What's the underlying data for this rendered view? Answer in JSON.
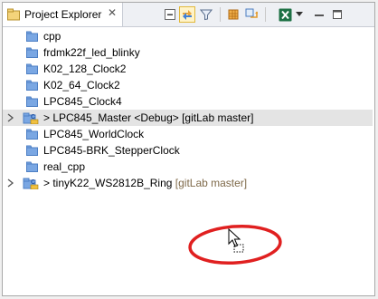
{
  "view": {
    "tab_title": "Project Explorer",
    "close_symbol": "✕",
    "icons": [
      "collapse-all-icon",
      "link-with-editor-icon",
      "filter-icon",
      "new-module-icon",
      "sync-icon",
      "excel-icon",
      "view-menu-icon"
    ]
  },
  "tree": [
    {
      "label": "cpp",
      "type": "folder"
    },
    {
      "label": "frdmk22f_led_blinky",
      "type": "folder"
    },
    {
      "label": "K02_128_Clock2",
      "type": "folder"
    },
    {
      "label": "K02_64_Clock2",
      "type": "folder"
    },
    {
      "label": "LPC845_Clock4",
      "type": "folder"
    },
    {
      "label": "> LPC845_Master <Debug> [gitLab master]",
      "type": "project"
    },
    {
      "label": "LPC845_WorldClock",
      "type": "folder"
    },
    {
      "label": "LPC845-BRK_StepperClock",
      "type": "folder"
    },
    {
      "label": "real_cpp",
      "type": "folder"
    },
    {
      "label": "> tinyK22_WS2812B_Ring",
      "git_label": " [gitLab master]",
      "type": "project"
    }
  ],
  "colors": {
    "folder": "#7aa7e3",
    "folder_dark": "#4d7fc4",
    "annotation": "#e02020",
    "selection": "#e4e4e4"
  }
}
